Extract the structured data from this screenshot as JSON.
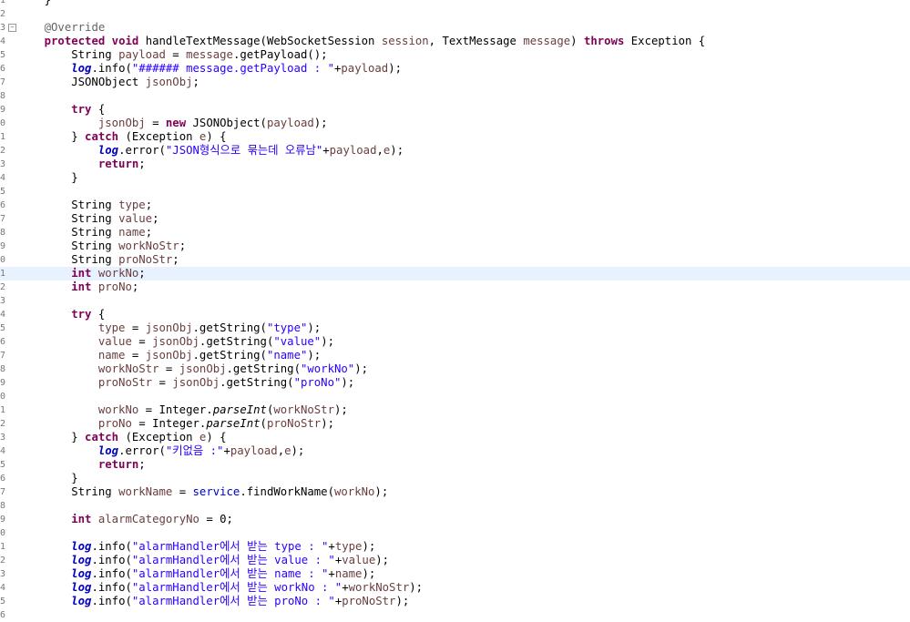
{
  "editor": {
    "lines": [
      {
        "n": "1",
        "tokens": [
          {
            "t": "    }",
            "c": ""
          }
        ]
      },
      {
        "n": "2",
        "tokens": []
      },
      {
        "n": "3",
        "fold": "⊖",
        "tokens": [
          {
            "t": "    ",
            "c": ""
          },
          {
            "t": "@Override",
            "c": "ann"
          }
        ]
      },
      {
        "n": "4",
        "tokens": [
          {
            "t": "    ",
            "c": ""
          },
          {
            "t": "protected",
            "c": "kw"
          },
          {
            "t": " ",
            "c": ""
          },
          {
            "t": "void",
            "c": "kw"
          },
          {
            "t": " handleTextMessage(WebSocketSession ",
            "c": ""
          },
          {
            "t": "session",
            "c": "var"
          },
          {
            "t": ", TextMessage ",
            "c": ""
          },
          {
            "t": "message",
            "c": "var"
          },
          {
            "t": ") ",
            "c": ""
          },
          {
            "t": "throws",
            "c": "kw"
          },
          {
            "t": " Exception {",
            "c": ""
          }
        ]
      },
      {
        "n": "5",
        "tokens": [
          {
            "t": "        String ",
            "c": ""
          },
          {
            "t": "payload",
            "c": "var"
          },
          {
            "t": " = ",
            "c": ""
          },
          {
            "t": "message",
            "c": "var"
          },
          {
            "t": ".getPayload();",
            "c": ""
          }
        ]
      },
      {
        "n": "6",
        "tokens": [
          {
            "t": "        ",
            "c": ""
          },
          {
            "t": "log",
            "c": "sfld"
          },
          {
            "t": ".info(",
            "c": ""
          },
          {
            "t": "\"###### message.getPayload : \"",
            "c": "str"
          },
          {
            "t": "+",
            "c": ""
          },
          {
            "t": "payload",
            "c": "var"
          },
          {
            "t": ");",
            "c": ""
          }
        ]
      },
      {
        "n": "7",
        "tokens": [
          {
            "t": "        JSONObject ",
            "c": ""
          },
          {
            "t": "jsonObj",
            "c": "var"
          },
          {
            "t": ";",
            "c": ""
          }
        ]
      },
      {
        "n": "8",
        "tokens": []
      },
      {
        "n": "9",
        "tokens": [
          {
            "t": "        ",
            "c": ""
          },
          {
            "t": "try",
            "c": "kw"
          },
          {
            "t": " {",
            "c": ""
          }
        ]
      },
      {
        "n": "0",
        "tokens": [
          {
            "t": "            ",
            "c": ""
          },
          {
            "t": "jsonObj",
            "c": "var"
          },
          {
            "t": " = ",
            "c": ""
          },
          {
            "t": "new",
            "c": "kw"
          },
          {
            "t": " JSONObject(",
            "c": ""
          },
          {
            "t": "payload",
            "c": "var"
          },
          {
            "t": ");",
            "c": ""
          }
        ]
      },
      {
        "n": "1",
        "tokens": [
          {
            "t": "        } ",
            "c": ""
          },
          {
            "t": "catch",
            "c": "kw"
          },
          {
            "t": " (Exception ",
            "c": ""
          },
          {
            "t": "e",
            "c": "var"
          },
          {
            "t": ") {",
            "c": ""
          }
        ]
      },
      {
        "n": "2",
        "tokens": [
          {
            "t": "            ",
            "c": ""
          },
          {
            "t": "log",
            "c": "sfld"
          },
          {
            "t": ".error(",
            "c": ""
          },
          {
            "t": "\"JSON형식으로 묶는데 오류남\"",
            "c": "str"
          },
          {
            "t": "+",
            "c": ""
          },
          {
            "t": "payload",
            "c": "var"
          },
          {
            "t": ",",
            "c": ""
          },
          {
            "t": "e",
            "c": "var"
          },
          {
            "t": ");",
            "c": ""
          }
        ]
      },
      {
        "n": "3",
        "tokens": [
          {
            "t": "            ",
            "c": ""
          },
          {
            "t": "return",
            "c": "kw"
          },
          {
            "t": ";",
            "c": ""
          }
        ]
      },
      {
        "n": "4",
        "tokens": [
          {
            "t": "        }",
            "c": ""
          }
        ]
      },
      {
        "n": "5",
        "tokens": []
      },
      {
        "n": "6",
        "tokens": [
          {
            "t": "        String ",
            "c": ""
          },
          {
            "t": "type",
            "c": "var"
          },
          {
            "t": ";",
            "c": ""
          }
        ]
      },
      {
        "n": "7",
        "tokens": [
          {
            "t": "        String ",
            "c": ""
          },
          {
            "t": "value",
            "c": "var"
          },
          {
            "t": ";",
            "c": ""
          }
        ]
      },
      {
        "n": "8",
        "tokens": [
          {
            "t": "        String ",
            "c": ""
          },
          {
            "t": "name",
            "c": "var"
          },
          {
            "t": ";",
            "c": ""
          }
        ]
      },
      {
        "n": "9",
        "tokens": [
          {
            "t": "        String ",
            "c": ""
          },
          {
            "t": "workNoStr",
            "c": "var"
          },
          {
            "t": ";",
            "c": ""
          }
        ]
      },
      {
        "n": "0",
        "tokens": [
          {
            "t": "        String ",
            "c": ""
          },
          {
            "t": "proNoStr",
            "c": "var"
          },
          {
            "t": ";",
            "c": ""
          }
        ]
      },
      {
        "n": "1",
        "hl": true,
        "tokens": [
          {
            "t": "        ",
            "c": ""
          },
          {
            "t": "int",
            "c": "kw"
          },
          {
            "t": " ",
            "c": ""
          },
          {
            "t": "workNo",
            "c": "var"
          },
          {
            "t": ";",
            "c": ""
          }
        ]
      },
      {
        "n": "2",
        "tokens": [
          {
            "t": "        ",
            "c": ""
          },
          {
            "t": "int",
            "c": "kw"
          },
          {
            "t": " ",
            "c": ""
          },
          {
            "t": "proNo",
            "c": "var"
          },
          {
            "t": ";",
            "c": ""
          }
        ]
      },
      {
        "n": "3",
        "tokens": []
      },
      {
        "n": "4",
        "tokens": [
          {
            "t": "        ",
            "c": ""
          },
          {
            "t": "try",
            "c": "kw"
          },
          {
            "t": " {",
            "c": ""
          }
        ]
      },
      {
        "n": "5",
        "tokens": [
          {
            "t": "            ",
            "c": ""
          },
          {
            "t": "type",
            "c": "var"
          },
          {
            "t": " = ",
            "c": ""
          },
          {
            "t": "jsonObj",
            "c": "var"
          },
          {
            "t": ".getString(",
            "c": ""
          },
          {
            "t": "\"type\"",
            "c": "str"
          },
          {
            "t": ");",
            "c": ""
          }
        ]
      },
      {
        "n": "6",
        "tokens": [
          {
            "t": "            ",
            "c": ""
          },
          {
            "t": "value",
            "c": "var"
          },
          {
            "t": " = ",
            "c": ""
          },
          {
            "t": "jsonObj",
            "c": "var"
          },
          {
            "t": ".getString(",
            "c": ""
          },
          {
            "t": "\"value\"",
            "c": "str"
          },
          {
            "t": ");",
            "c": ""
          }
        ]
      },
      {
        "n": "7",
        "tokens": [
          {
            "t": "            ",
            "c": ""
          },
          {
            "t": "name",
            "c": "var"
          },
          {
            "t": " = ",
            "c": ""
          },
          {
            "t": "jsonObj",
            "c": "var"
          },
          {
            "t": ".getString(",
            "c": ""
          },
          {
            "t": "\"name\"",
            "c": "str"
          },
          {
            "t": ");",
            "c": ""
          }
        ]
      },
      {
        "n": "8",
        "tokens": [
          {
            "t": "            ",
            "c": ""
          },
          {
            "t": "workNoStr",
            "c": "var"
          },
          {
            "t": " = ",
            "c": ""
          },
          {
            "t": "jsonObj",
            "c": "var"
          },
          {
            "t": ".getString(",
            "c": ""
          },
          {
            "t": "\"workNo\"",
            "c": "str"
          },
          {
            "t": ");",
            "c": ""
          }
        ]
      },
      {
        "n": "9",
        "tokens": [
          {
            "t": "            ",
            "c": ""
          },
          {
            "t": "proNoStr",
            "c": "var"
          },
          {
            "t": " = ",
            "c": ""
          },
          {
            "t": "jsonObj",
            "c": "var"
          },
          {
            "t": ".getString(",
            "c": ""
          },
          {
            "t": "\"proNo\"",
            "c": "str"
          },
          {
            "t": ");",
            "c": ""
          }
        ]
      },
      {
        "n": "0",
        "tokens": []
      },
      {
        "n": "1",
        "tokens": [
          {
            "t": "            ",
            "c": ""
          },
          {
            "t": "workNo",
            "c": "var"
          },
          {
            "t": " = Integer.",
            "c": ""
          },
          {
            "t": "parseInt",
            "c": "ital"
          },
          {
            "t": "(",
            "c": ""
          },
          {
            "t": "workNoStr",
            "c": "var"
          },
          {
            "t": ");",
            "c": ""
          }
        ]
      },
      {
        "n": "2",
        "tokens": [
          {
            "t": "            ",
            "c": ""
          },
          {
            "t": "proNo",
            "c": "var"
          },
          {
            "t": " = Integer.",
            "c": ""
          },
          {
            "t": "parseInt",
            "c": "ital"
          },
          {
            "t": "(",
            "c": ""
          },
          {
            "t": "proNoStr",
            "c": "var"
          },
          {
            "t": ");",
            "c": ""
          }
        ]
      },
      {
        "n": "3",
        "tokens": [
          {
            "t": "        } ",
            "c": ""
          },
          {
            "t": "catch",
            "c": "kw"
          },
          {
            "t": " (Exception ",
            "c": ""
          },
          {
            "t": "e",
            "c": "var"
          },
          {
            "t": ") {",
            "c": ""
          }
        ]
      },
      {
        "n": "4",
        "tokens": [
          {
            "t": "            ",
            "c": ""
          },
          {
            "t": "log",
            "c": "sfld"
          },
          {
            "t": ".error(",
            "c": ""
          },
          {
            "t": "\"키없음 :\"",
            "c": "str"
          },
          {
            "t": "+",
            "c": ""
          },
          {
            "t": "payload",
            "c": "var"
          },
          {
            "t": ",",
            "c": ""
          },
          {
            "t": "e",
            "c": "var"
          },
          {
            "t": ");",
            "c": ""
          }
        ]
      },
      {
        "n": "5",
        "tokens": [
          {
            "t": "            ",
            "c": ""
          },
          {
            "t": "return",
            "c": "kw"
          },
          {
            "t": ";",
            "c": ""
          }
        ]
      },
      {
        "n": "6",
        "tokens": [
          {
            "t": "        }",
            "c": ""
          }
        ]
      },
      {
        "n": "7",
        "tokens": [
          {
            "t": "        String ",
            "c": ""
          },
          {
            "t": "workName",
            "c": "var"
          },
          {
            "t": " = ",
            "c": ""
          },
          {
            "t": "service",
            "c": "fld"
          },
          {
            "t": ".findWorkName(",
            "c": ""
          },
          {
            "t": "workNo",
            "c": "var"
          },
          {
            "t": ");",
            "c": ""
          }
        ]
      },
      {
        "n": "8",
        "tokens": []
      },
      {
        "n": "9",
        "tokens": [
          {
            "t": "        ",
            "c": ""
          },
          {
            "t": "int",
            "c": "kw"
          },
          {
            "t": " ",
            "c": ""
          },
          {
            "t": "alarmCategoryNo",
            "c": "var"
          },
          {
            "t": " = 0;",
            "c": ""
          }
        ]
      },
      {
        "n": "0",
        "tokens": []
      },
      {
        "n": "1",
        "tokens": [
          {
            "t": "        ",
            "c": ""
          },
          {
            "t": "log",
            "c": "sfld"
          },
          {
            "t": ".info(",
            "c": ""
          },
          {
            "t": "\"alarmHandler에서 받는 type : \"",
            "c": "str"
          },
          {
            "t": "+",
            "c": ""
          },
          {
            "t": "type",
            "c": "var"
          },
          {
            "t": ");",
            "c": ""
          }
        ]
      },
      {
        "n": "2",
        "tokens": [
          {
            "t": "        ",
            "c": ""
          },
          {
            "t": "log",
            "c": "sfld"
          },
          {
            "t": ".info(",
            "c": ""
          },
          {
            "t": "\"alarmHandler에서 받는 value : \"",
            "c": "str"
          },
          {
            "t": "+",
            "c": ""
          },
          {
            "t": "value",
            "c": "var"
          },
          {
            "t": ");",
            "c": ""
          }
        ]
      },
      {
        "n": "3",
        "tokens": [
          {
            "t": "        ",
            "c": ""
          },
          {
            "t": "log",
            "c": "sfld"
          },
          {
            "t": ".info(",
            "c": ""
          },
          {
            "t": "\"alarmHandler에서 받는 name : \"",
            "c": "str"
          },
          {
            "t": "+",
            "c": ""
          },
          {
            "t": "name",
            "c": "var"
          },
          {
            "t": ");",
            "c": ""
          }
        ]
      },
      {
        "n": "4",
        "tokens": [
          {
            "t": "        ",
            "c": ""
          },
          {
            "t": "log",
            "c": "sfld"
          },
          {
            "t": ".info(",
            "c": ""
          },
          {
            "t": "\"alarmHandler에서 받는 workNo : \"",
            "c": "str"
          },
          {
            "t": "+",
            "c": ""
          },
          {
            "t": "workNoStr",
            "c": "var"
          },
          {
            "t": ");",
            "c": ""
          }
        ]
      },
      {
        "n": "5",
        "tokens": [
          {
            "t": "        ",
            "c": ""
          },
          {
            "t": "log",
            "c": "sfld"
          },
          {
            "t": ".info(",
            "c": ""
          },
          {
            "t": "\"alarmHandler에서 받는 proNo : \"",
            "c": "str"
          },
          {
            "t": "+",
            "c": ""
          },
          {
            "t": "proNoStr",
            "c": "var"
          },
          {
            "t": ");",
            "c": ""
          }
        ]
      },
      {
        "n": "6",
        "tokens": []
      }
    ]
  }
}
